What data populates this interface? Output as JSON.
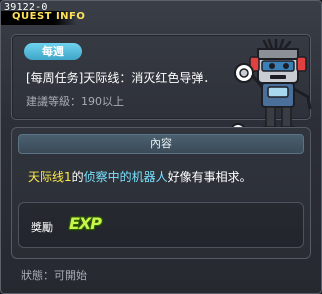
{
  "window": {
    "quest_id": "39122-0",
    "title": "QUEST INFO"
  },
  "quest": {
    "badge": "每週",
    "name": "[每周任务]天际线：消灭红色导弹．",
    "level": "建議等級：190以上",
    "npc_icon": "robot-npc-icon"
  },
  "content": {
    "header": "內容",
    "desc_part1": "天际线1",
    "desc_part2": "的",
    "desc_part3": "侦察中的机器人",
    "desc_part4": "好像有事相求。",
    "reward_label": "獎勵",
    "reward_exp": "EXP"
  },
  "status": "狀態：可開始",
  "colors": {
    "title": "#ffe15a",
    "badge": "#4fb8d8",
    "highlight_yellow": "#ffe94a",
    "highlight_cyan": "#7ae2ff",
    "exp": "#c8f54a"
  }
}
